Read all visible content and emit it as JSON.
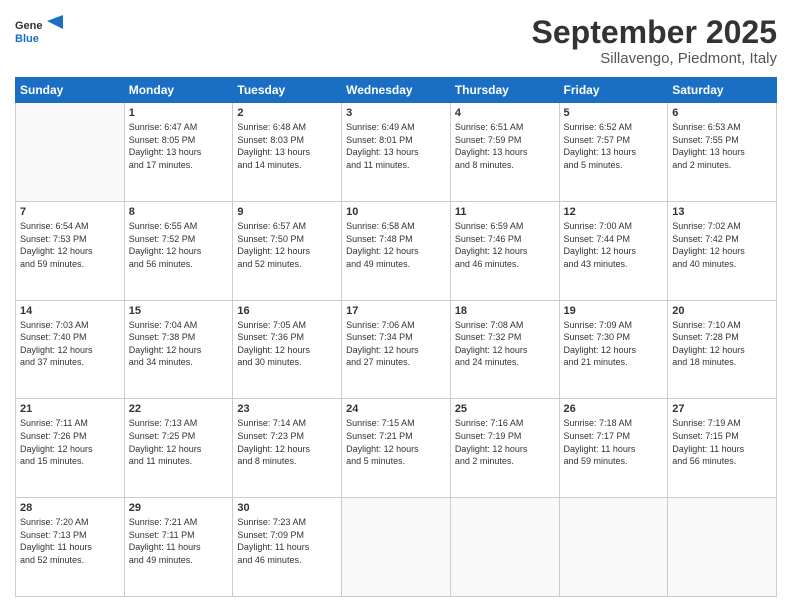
{
  "header": {
    "logo": {
      "general": "General",
      "blue": "Blue"
    },
    "title": "September 2025",
    "subtitle": "Sillavengo, Piedmont, Italy"
  },
  "days_of_week": [
    "Sunday",
    "Monday",
    "Tuesday",
    "Wednesday",
    "Thursday",
    "Friday",
    "Saturday"
  ],
  "weeks": [
    [
      {
        "day": "",
        "info": ""
      },
      {
        "day": "1",
        "info": "Sunrise: 6:47 AM\nSunset: 8:05 PM\nDaylight: 13 hours\nand 17 minutes."
      },
      {
        "day": "2",
        "info": "Sunrise: 6:48 AM\nSunset: 8:03 PM\nDaylight: 13 hours\nand 14 minutes."
      },
      {
        "day": "3",
        "info": "Sunrise: 6:49 AM\nSunset: 8:01 PM\nDaylight: 13 hours\nand 11 minutes."
      },
      {
        "day": "4",
        "info": "Sunrise: 6:51 AM\nSunset: 7:59 PM\nDaylight: 13 hours\nand 8 minutes."
      },
      {
        "day": "5",
        "info": "Sunrise: 6:52 AM\nSunset: 7:57 PM\nDaylight: 13 hours\nand 5 minutes."
      },
      {
        "day": "6",
        "info": "Sunrise: 6:53 AM\nSunset: 7:55 PM\nDaylight: 13 hours\nand 2 minutes."
      }
    ],
    [
      {
        "day": "7",
        "info": "Sunrise: 6:54 AM\nSunset: 7:53 PM\nDaylight: 12 hours\nand 59 minutes."
      },
      {
        "day": "8",
        "info": "Sunrise: 6:55 AM\nSunset: 7:52 PM\nDaylight: 12 hours\nand 56 minutes."
      },
      {
        "day": "9",
        "info": "Sunrise: 6:57 AM\nSunset: 7:50 PM\nDaylight: 12 hours\nand 52 minutes."
      },
      {
        "day": "10",
        "info": "Sunrise: 6:58 AM\nSunset: 7:48 PM\nDaylight: 12 hours\nand 49 minutes."
      },
      {
        "day": "11",
        "info": "Sunrise: 6:59 AM\nSunset: 7:46 PM\nDaylight: 12 hours\nand 46 minutes."
      },
      {
        "day": "12",
        "info": "Sunrise: 7:00 AM\nSunset: 7:44 PM\nDaylight: 12 hours\nand 43 minutes."
      },
      {
        "day": "13",
        "info": "Sunrise: 7:02 AM\nSunset: 7:42 PM\nDaylight: 12 hours\nand 40 minutes."
      }
    ],
    [
      {
        "day": "14",
        "info": "Sunrise: 7:03 AM\nSunset: 7:40 PM\nDaylight: 12 hours\nand 37 minutes."
      },
      {
        "day": "15",
        "info": "Sunrise: 7:04 AM\nSunset: 7:38 PM\nDaylight: 12 hours\nand 34 minutes."
      },
      {
        "day": "16",
        "info": "Sunrise: 7:05 AM\nSunset: 7:36 PM\nDaylight: 12 hours\nand 30 minutes."
      },
      {
        "day": "17",
        "info": "Sunrise: 7:06 AM\nSunset: 7:34 PM\nDaylight: 12 hours\nand 27 minutes."
      },
      {
        "day": "18",
        "info": "Sunrise: 7:08 AM\nSunset: 7:32 PM\nDaylight: 12 hours\nand 24 minutes."
      },
      {
        "day": "19",
        "info": "Sunrise: 7:09 AM\nSunset: 7:30 PM\nDaylight: 12 hours\nand 21 minutes."
      },
      {
        "day": "20",
        "info": "Sunrise: 7:10 AM\nSunset: 7:28 PM\nDaylight: 12 hours\nand 18 minutes."
      }
    ],
    [
      {
        "day": "21",
        "info": "Sunrise: 7:11 AM\nSunset: 7:26 PM\nDaylight: 12 hours\nand 15 minutes."
      },
      {
        "day": "22",
        "info": "Sunrise: 7:13 AM\nSunset: 7:25 PM\nDaylight: 12 hours\nand 11 minutes."
      },
      {
        "day": "23",
        "info": "Sunrise: 7:14 AM\nSunset: 7:23 PM\nDaylight: 12 hours\nand 8 minutes."
      },
      {
        "day": "24",
        "info": "Sunrise: 7:15 AM\nSunset: 7:21 PM\nDaylight: 12 hours\nand 5 minutes."
      },
      {
        "day": "25",
        "info": "Sunrise: 7:16 AM\nSunset: 7:19 PM\nDaylight: 12 hours\nand 2 minutes."
      },
      {
        "day": "26",
        "info": "Sunrise: 7:18 AM\nSunset: 7:17 PM\nDaylight: 11 hours\nand 59 minutes."
      },
      {
        "day": "27",
        "info": "Sunrise: 7:19 AM\nSunset: 7:15 PM\nDaylight: 11 hours\nand 56 minutes."
      }
    ],
    [
      {
        "day": "28",
        "info": "Sunrise: 7:20 AM\nSunset: 7:13 PM\nDaylight: 11 hours\nand 52 minutes."
      },
      {
        "day": "29",
        "info": "Sunrise: 7:21 AM\nSunset: 7:11 PM\nDaylight: 11 hours\nand 49 minutes."
      },
      {
        "day": "30",
        "info": "Sunrise: 7:23 AM\nSunset: 7:09 PM\nDaylight: 11 hours\nand 46 minutes."
      },
      {
        "day": "",
        "info": ""
      },
      {
        "day": "",
        "info": ""
      },
      {
        "day": "",
        "info": ""
      },
      {
        "day": "",
        "info": ""
      }
    ]
  ]
}
